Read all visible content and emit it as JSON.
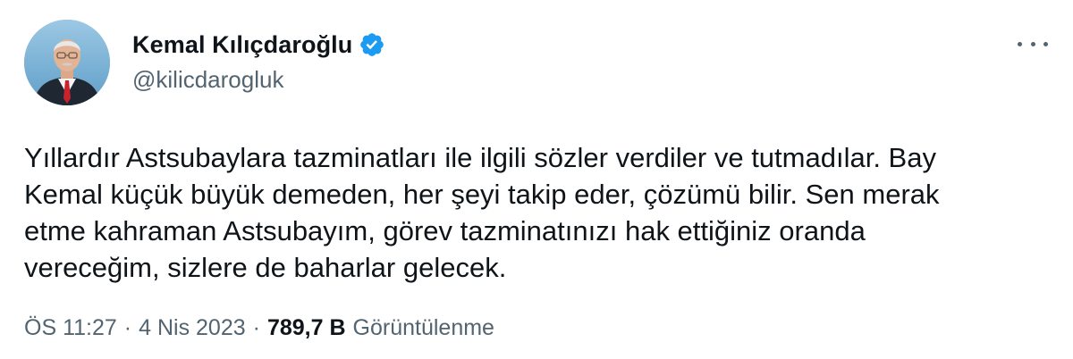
{
  "author": {
    "display_name": "Kemal Kılıçdaroğlu",
    "handle": "@kilicdarogluk",
    "verified": true
  },
  "tweet": {
    "text": "Yıllardır Astsubaylara tazminatları ile ilgili sözler verdiler ve tutmadılar. Bay\nKemal küçük büyük demeden, her şeyi takip eder, çözümü bilir. Sen merak\netme kahraman Astsubayım, görev tazminatınızı hak ettiğiniz oranda\nvereceğim, sizlere de baharlar gelecek."
  },
  "meta": {
    "time": "ÖS 11:27",
    "separator": "·",
    "date": "4 Nis 2023",
    "views_count": "789,7 B",
    "views_label": "Görüntülenme"
  },
  "colors": {
    "text_primary": "#0f1419",
    "text_secondary": "#536471",
    "verified_blue": "#1d9bf0"
  },
  "icons": {
    "verified": "verified-badge-icon",
    "more": "more-options-icon",
    "avatar": "profile-photo"
  }
}
